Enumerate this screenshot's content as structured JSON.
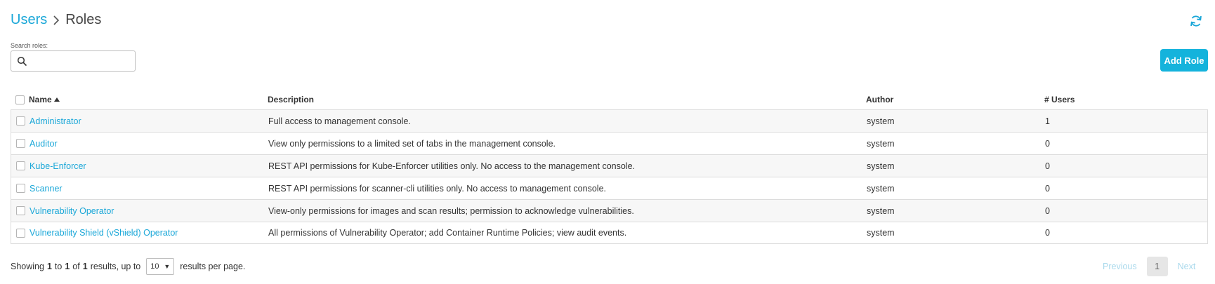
{
  "breadcrumb": {
    "parent": "Users",
    "current": "Roles"
  },
  "icons": {
    "separator": "chevron-right-icon",
    "refresh": "refresh-icon",
    "search": "search-icon",
    "sort": "sort-asc-icon"
  },
  "colors": {
    "accent": "#1aa7d8",
    "button": "#14b3dc"
  },
  "search": {
    "label": "Search roles:",
    "placeholder": "",
    "value": ""
  },
  "actions": {
    "add_role": "Add Role"
  },
  "table": {
    "headers": {
      "name": "Name",
      "description": "Description",
      "author": "Author",
      "users": "# Users"
    },
    "rows": [
      {
        "name": "Administrator",
        "description": "Full access to management console.",
        "author": "system",
        "users": "1"
      },
      {
        "name": "Auditor",
        "description": "View only permissions to a limited set of tabs in the management console.",
        "author": "system",
        "users": "0"
      },
      {
        "name": "Kube-Enforcer",
        "description": "REST API permissions for Kube-Enforcer utilities only. No access to the management console.",
        "author": "system",
        "users": "0"
      },
      {
        "name": "Scanner",
        "description": "REST API permissions for scanner-cli utilities only. No access to management console.",
        "author": "system",
        "users": "0"
      },
      {
        "name": "Vulnerability Operator",
        "description": "View-only permissions for images and scan results; permission to acknowledge vulnerabilities.",
        "author": "system",
        "users": "0"
      },
      {
        "name": "Vulnerability Shield (vShield) Operator",
        "description": "All permissions of Vulnerability Operator; add Container Runtime Policies; view audit events.",
        "author": "system",
        "users": "0"
      }
    ]
  },
  "footer": {
    "showing": "Showing",
    "from": "1",
    "to_word": "to",
    "to": "1",
    "of_word": "of",
    "total": "1",
    "results_up_to": "results, up to",
    "per_page_value": "10",
    "results_per_page": "results per page."
  },
  "pagination": {
    "previous": "Previous",
    "page": "1",
    "next": "Next"
  }
}
